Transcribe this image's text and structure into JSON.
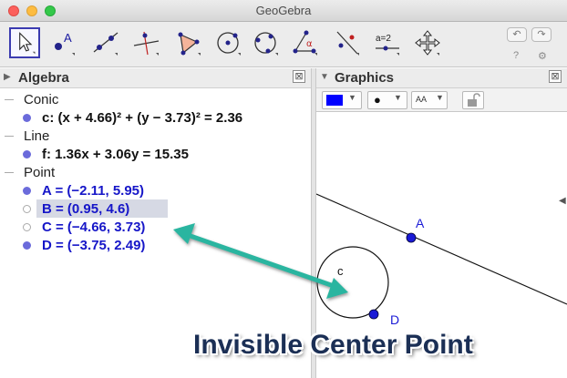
{
  "window": {
    "title": "GeoGebra"
  },
  "toolbar": {
    "tools": [
      {
        "name": "move-tool",
        "icon": "arrow-cursor-icon",
        "selected": true
      },
      {
        "name": "point-tool",
        "icon": "point-icon",
        "label": "A"
      },
      {
        "name": "line-tool",
        "icon": "line-icon"
      },
      {
        "name": "perpendicular-tool",
        "icon": "perpendicular-line-icon"
      },
      {
        "name": "polygon-tool",
        "icon": "polygon-icon"
      },
      {
        "name": "circle-tool",
        "icon": "circle-center-point-icon"
      },
      {
        "name": "circle-three-points-tool",
        "icon": "circle-three-points-icon"
      },
      {
        "name": "angle-tool",
        "icon": "angle-icon",
        "label": "α"
      },
      {
        "name": "reflect-tool",
        "icon": "reflect-line-icon"
      },
      {
        "name": "slider-tool",
        "icon": "slider-icon",
        "label": "a=2"
      },
      {
        "name": "move-view-tool",
        "icon": "move-graphics-view-icon"
      }
    ],
    "undo": "↶",
    "redo": "↷",
    "help": "?",
    "settings": "⚙"
  },
  "algebra": {
    "title": "Algebra",
    "close": "⊠",
    "groups": [
      {
        "header": "Conic",
        "items": [
          {
            "text": "c: (x + 4.66)² + (y − 3.73)² = 2.36",
            "visible": true,
            "color": "black"
          }
        ]
      },
      {
        "header": "Line",
        "items": [
          {
            "text": "f: 1.36x + 3.06y = 15.35",
            "visible": true,
            "color": "black"
          }
        ]
      },
      {
        "header": "Point",
        "items": [
          {
            "text": "A = (−2.11, 5.95)",
            "visible": true,
            "color": "blue"
          },
          {
            "text": "B = (0.95, 4.6)",
            "visible": false,
            "color": "blue",
            "highlighted": true
          },
          {
            "text": "C = (−4.66, 3.73)",
            "visible": false,
            "color": "blue"
          },
          {
            "text": "D = (−3.75, 2.49)",
            "visible": true,
            "color": "blue"
          }
        ]
      }
    ]
  },
  "graphics": {
    "title": "Graphics",
    "close": "⊠",
    "stylebar": {
      "color": "#0000ff",
      "point_style": "●",
      "label_style": "AA"
    },
    "labels": {
      "A": "A",
      "C": "c",
      "D": "D"
    },
    "colors": {
      "point": "#1a1ad6",
      "line": "#000000"
    }
  },
  "annotation": {
    "text": "Invisible Center Point",
    "arrow_color": "#2bb5a0"
  }
}
